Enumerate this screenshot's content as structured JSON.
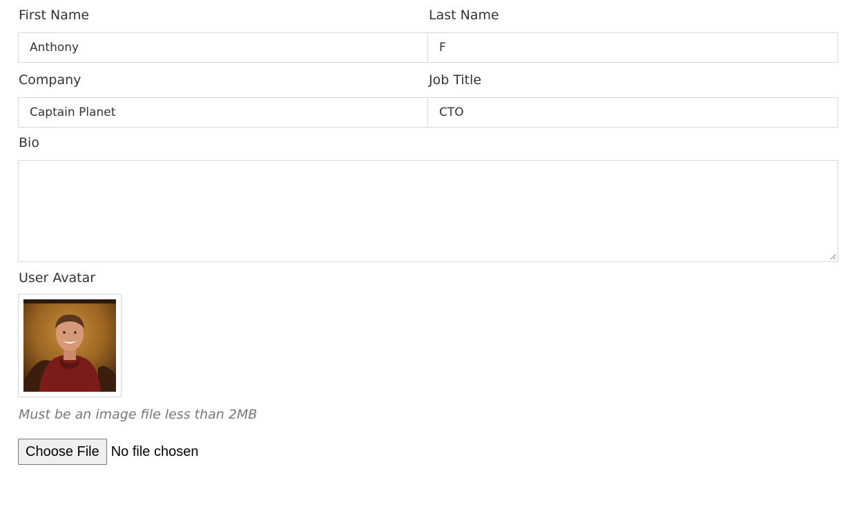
{
  "form": {
    "first_name": {
      "label": "First Name",
      "value": "Anthony"
    },
    "last_name": {
      "label": "Last Name",
      "value": "F"
    },
    "company": {
      "label": "Company",
      "value": "Captain Planet"
    },
    "job_title": {
      "label": "Job Title",
      "value": "CTO"
    },
    "bio": {
      "label": "Bio",
      "value": ""
    },
    "avatar": {
      "label": "User Avatar",
      "hint": "Must be an image file less than 2MB",
      "choose_button": "Choose File",
      "file_status": "No file chosen"
    }
  },
  "colors": {
    "border": "#d9d9d9",
    "text": "#333333",
    "hint": "#777777"
  }
}
